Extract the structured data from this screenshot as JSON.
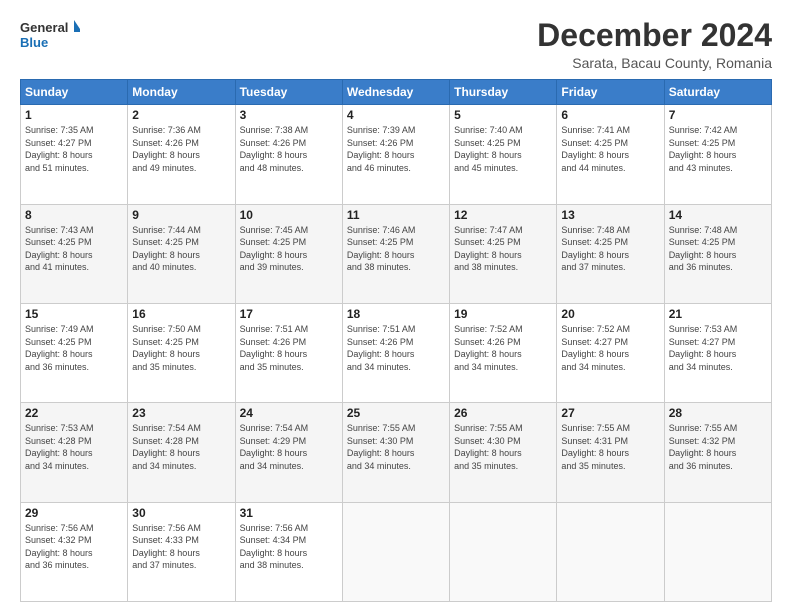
{
  "logo": {
    "line1": "General",
    "line2": "Blue"
  },
  "header": {
    "month": "December 2024",
    "location": "Sarata, Bacau County, Romania"
  },
  "weekdays": [
    "Sunday",
    "Monday",
    "Tuesday",
    "Wednesday",
    "Thursday",
    "Friday",
    "Saturday"
  ],
  "weeks": [
    [
      {
        "day": "1",
        "info": "Sunrise: 7:35 AM\nSunset: 4:27 PM\nDaylight: 8 hours\nand 51 minutes."
      },
      {
        "day": "2",
        "info": "Sunrise: 7:36 AM\nSunset: 4:26 PM\nDaylight: 8 hours\nand 49 minutes."
      },
      {
        "day": "3",
        "info": "Sunrise: 7:38 AM\nSunset: 4:26 PM\nDaylight: 8 hours\nand 48 minutes."
      },
      {
        "day": "4",
        "info": "Sunrise: 7:39 AM\nSunset: 4:26 PM\nDaylight: 8 hours\nand 46 minutes."
      },
      {
        "day": "5",
        "info": "Sunrise: 7:40 AM\nSunset: 4:25 PM\nDaylight: 8 hours\nand 45 minutes."
      },
      {
        "day": "6",
        "info": "Sunrise: 7:41 AM\nSunset: 4:25 PM\nDaylight: 8 hours\nand 44 minutes."
      },
      {
        "day": "7",
        "info": "Sunrise: 7:42 AM\nSunset: 4:25 PM\nDaylight: 8 hours\nand 43 minutes."
      }
    ],
    [
      {
        "day": "8",
        "info": "Sunrise: 7:43 AM\nSunset: 4:25 PM\nDaylight: 8 hours\nand 41 minutes."
      },
      {
        "day": "9",
        "info": "Sunrise: 7:44 AM\nSunset: 4:25 PM\nDaylight: 8 hours\nand 40 minutes."
      },
      {
        "day": "10",
        "info": "Sunrise: 7:45 AM\nSunset: 4:25 PM\nDaylight: 8 hours\nand 39 minutes."
      },
      {
        "day": "11",
        "info": "Sunrise: 7:46 AM\nSunset: 4:25 PM\nDaylight: 8 hours\nand 38 minutes."
      },
      {
        "day": "12",
        "info": "Sunrise: 7:47 AM\nSunset: 4:25 PM\nDaylight: 8 hours\nand 38 minutes."
      },
      {
        "day": "13",
        "info": "Sunrise: 7:48 AM\nSunset: 4:25 PM\nDaylight: 8 hours\nand 37 minutes."
      },
      {
        "day": "14",
        "info": "Sunrise: 7:48 AM\nSunset: 4:25 PM\nDaylight: 8 hours\nand 36 minutes."
      }
    ],
    [
      {
        "day": "15",
        "info": "Sunrise: 7:49 AM\nSunset: 4:25 PM\nDaylight: 8 hours\nand 36 minutes."
      },
      {
        "day": "16",
        "info": "Sunrise: 7:50 AM\nSunset: 4:25 PM\nDaylight: 8 hours\nand 35 minutes."
      },
      {
        "day": "17",
        "info": "Sunrise: 7:51 AM\nSunset: 4:26 PM\nDaylight: 8 hours\nand 35 minutes."
      },
      {
        "day": "18",
        "info": "Sunrise: 7:51 AM\nSunset: 4:26 PM\nDaylight: 8 hours\nand 34 minutes."
      },
      {
        "day": "19",
        "info": "Sunrise: 7:52 AM\nSunset: 4:26 PM\nDaylight: 8 hours\nand 34 minutes."
      },
      {
        "day": "20",
        "info": "Sunrise: 7:52 AM\nSunset: 4:27 PM\nDaylight: 8 hours\nand 34 minutes."
      },
      {
        "day": "21",
        "info": "Sunrise: 7:53 AM\nSunset: 4:27 PM\nDaylight: 8 hours\nand 34 minutes."
      }
    ],
    [
      {
        "day": "22",
        "info": "Sunrise: 7:53 AM\nSunset: 4:28 PM\nDaylight: 8 hours\nand 34 minutes."
      },
      {
        "day": "23",
        "info": "Sunrise: 7:54 AM\nSunset: 4:28 PM\nDaylight: 8 hours\nand 34 minutes."
      },
      {
        "day": "24",
        "info": "Sunrise: 7:54 AM\nSunset: 4:29 PM\nDaylight: 8 hours\nand 34 minutes."
      },
      {
        "day": "25",
        "info": "Sunrise: 7:55 AM\nSunset: 4:30 PM\nDaylight: 8 hours\nand 34 minutes."
      },
      {
        "day": "26",
        "info": "Sunrise: 7:55 AM\nSunset: 4:30 PM\nDaylight: 8 hours\nand 35 minutes."
      },
      {
        "day": "27",
        "info": "Sunrise: 7:55 AM\nSunset: 4:31 PM\nDaylight: 8 hours\nand 35 minutes."
      },
      {
        "day": "28",
        "info": "Sunrise: 7:55 AM\nSunset: 4:32 PM\nDaylight: 8 hours\nand 36 minutes."
      }
    ],
    [
      {
        "day": "29",
        "info": "Sunrise: 7:56 AM\nSunset: 4:32 PM\nDaylight: 8 hours\nand 36 minutes."
      },
      {
        "day": "30",
        "info": "Sunrise: 7:56 AM\nSunset: 4:33 PM\nDaylight: 8 hours\nand 37 minutes."
      },
      {
        "day": "31",
        "info": "Sunrise: 7:56 AM\nSunset: 4:34 PM\nDaylight: 8 hours\nand 38 minutes."
      },
      {
        "day": "",
        "info": ""
      },
      {
        "day": "",
        "info": ""
      },
      {
        "day": "",
        "info": ""
      },
      {
        "day": "",
        "info": ""
      }
    ]
  ]
}
